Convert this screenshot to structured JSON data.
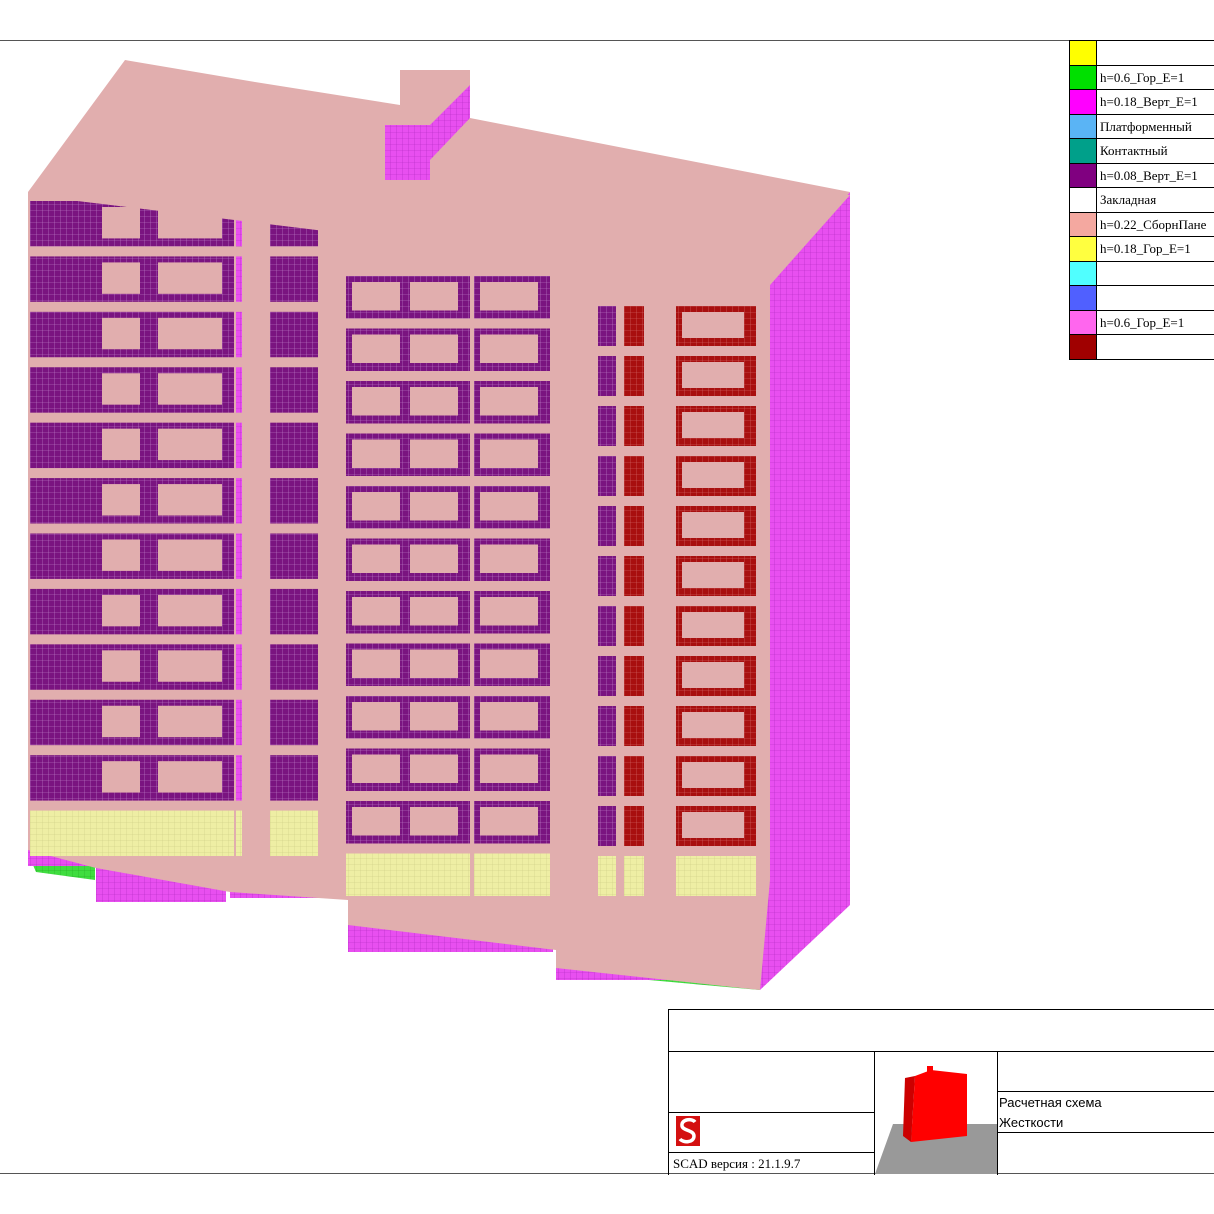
{
  "legend": [
    {
      "color": "#ffff00",
      "label": ""
    },
    {
      "color": "#00e000",
      "label": "h=0.6_Гор_E=1"
    },
    {
      "color": "#ff00ff",
      "label": "h=0.18_Верт_E=1"
    },
    {
      "color": "#5ab4f5",
      "label": "Платформенный"
    },
    {
      "color": "#00a08a",
      "label": "Контактный"
    },
    {
      "color": "#800080",
      "label": "h=0.08_Верт_E=1"
    },
    {
      "color": "#ffffff",
      "label": "Закладная"
    },
    {
      "color": "#f4a8a0",
      "label": "h=0.22_СборнПане"
    },
    {
      "color": "#ffff40",
      "label": "h=0.18_Гор_E=1"
    },
    {
      "color": "#50ffff",
      "label": ""
    },
    {
      "color": "#5060ff",
      "label": ""
    },
    {
      "color": "#ff66ee",
      "label": "h=0.6_Гор_E=1"
    },
    {
      "color": "#a00000",
      "label": ""
    }
  ],
  "stamp": {
    "version": "SCAD версия : 21.1.9.7",
    "scheme_title": "Расчетная схема",
    "scheme_subtitle": "Жесткости"
  },
  "model": {
    "floors": 12,
    "colors": {
      "slab": "#e1aeae",
      "wall_violet": "#7a1480",
      "wall_magenta": "#e84ff0",
      "wall_red": "#a80f0f",
      "basement_yellow": "#eeeea4",
      "ground_green": "#40dd40",
      "side_wall": "#e44ff2",
      "thumb_red": "#ff0000",
      "thumb_base": "#999999"
    }
  }
}
